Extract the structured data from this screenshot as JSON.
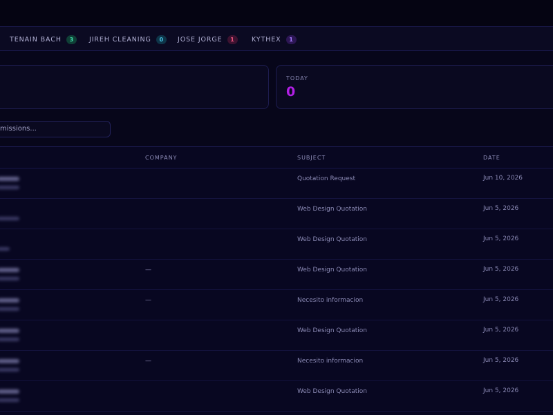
{
  "tabs": [
    {
      "label": "TENAIN BACH",
      "count": "3",
      "color": "green"
    },
    {
      "label": "JIREH CLEANING",
      "count": "0",
      "color": "teal"
    },
    {
      "label": "JOSE JORGE",
      "count": "1",
      "color": "red"
    },
    {
      "label": "KYTHEX",
      "count": "1",
      "color": "purple"
    }
  ],
  "stats": {
    "today_label": "TODAY",
    "today_value": "0"
  },
  "search": {
    "placeholder": "missions..."
  },
  "table": {
    "headers": {
      "company": "COMPANY",
      "subject": "SUBJECT",
      "date": "DATE"
    },
    "rows": [
      {
        "company": "",
        "subject": "Quotation Request",
        "date": "Jun 10, 2026"
      },
      {
        "company": "",
        "subject": "Web Design Quotation",
        "date": "Jun 5, 2026"
      },
      {
        "company": "",
        "subject": "Web Design Quotation",
        "date": "Jun 5, 2026"
      },
      {
        "company": "—",
        "subject": "Web Design Quotation",
        "date": "Jun 5, 2026"
      },
      {
        "company": "—",
        "subject": "Necesito informacion",
        "date": "Jun 5, 2026"
      },
      {
        "company": "",
        "subject": "Web Design Quotation",
        "date": "Jun 5, 2026"
      },
      {
        "company": "—",
        "subject": "Necesito informacion",
        "date": "Jun 5, 2026"
      },
      {
        "company": "",
        "subject": "Web Design Quotation",
        "date": "Jun 5, 2026"
      }
    ]
  },
  "colors": {
    "accent": "#b21fe5",
    "background": "#07061a"
  }
}
